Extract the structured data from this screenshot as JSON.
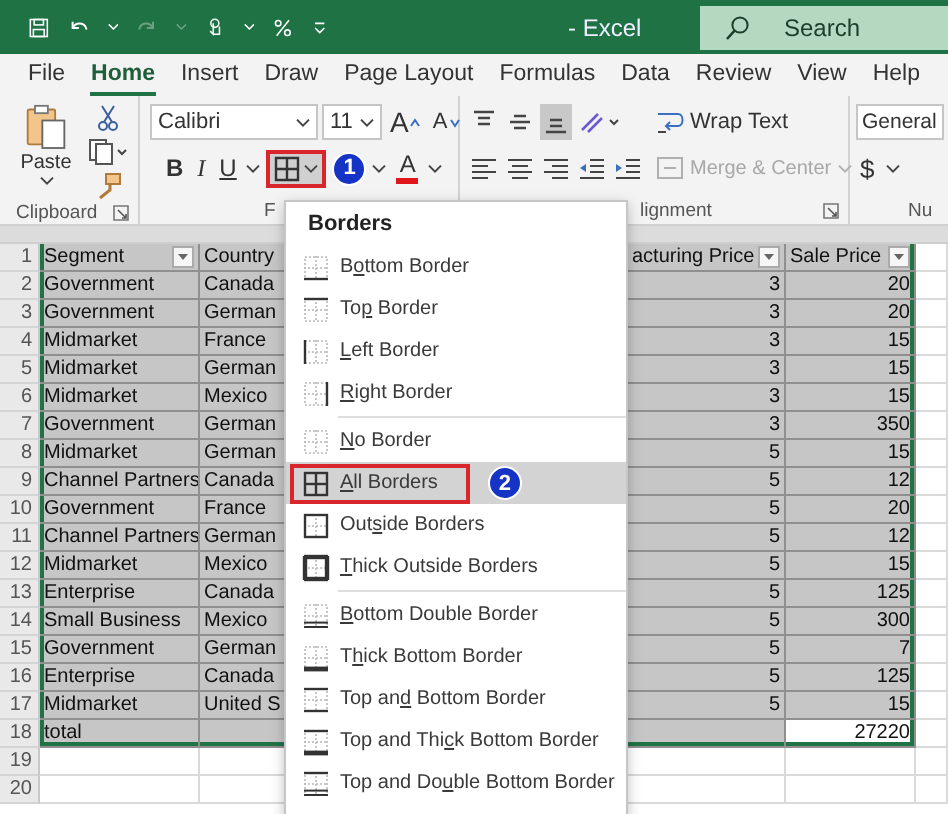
{
  "title_bar": {
    "title": "- Excel",
    "search": {
      "placeholder": "Search"
    }
  },
  "ribbon": {
    "tabs": [
      {
        "label": "File",
        "selected": false
      },
      {
        "label": "Home",
        "selected": true
      },
      {
        "label": "Insert",
        "selected": false
      },
      {
        "label": "Draw",
        "selected": false
      },
      {
        "label": "Page Layout",
        "selected": false
      },
      {
        "label": "Formulas",
        "selected": false
      },
      {
        "label": "Data",
        "selected": false
      },
      {
        "label": "Review",
        "selected": false
      },
      {
        "label": "View",
        "selected": false
      },
      {
        "label": "Help",
        "selected": false
      }
    ],
    "clipboard": {
      "paste": "Paste",
      "group": "Clipboard"
    },
    "font": {
      "name": "Calibri",
      "size": "11",
      "grow": "A",
      "shrink": "A",
      "bold": "B",
      "italic": "I",
      "underline": "U",
      "font_color": "A",
      "borders_callout": "1",
      "group": "F"
    },
    "alignment": {
      "vertical": [
        {
          "kind": "top",
          "selected": false
        },
        {
          "kind": "middle",
          "selected": false
        },
        {
          "kind": "bottom",
          "selected": true
        }
      ],
      "wrap_text": "Wrap Text",
      "merge": {
        "label": "Merge & Center",
        "disabled": true
      },
      "group": "lignment"
    },
    "number": {
      "format": "General",
      "currency": "$",
      "group": "Nu"
    }
  },
  "borders_menu": {
    "title": "Borders",
    "groups": [
      {
        "items": [
          {
            "kind": "bottom",
            "pre": "B",
            "key": "o",
            "post": "ttom Border",
            "selected": false
          },
          {
            "kind": "top",
            "pre": "To",
            "key": "p",
            "post": " Border",
            "selected": false
          },
          {
            "kind": "left",
            "key": "L",
            "post": "eft Border",
            "selected": false
          },
          {
            "kind": "right",
            "key": "R",
            "post": "ight Border",
            "selected": false
          }
        ]
      },
      {
        "items": [
          {
            "kind": "none",
            "key": "N",
            "post": "o Border",
            "selected": false
          },
          {
            "kind": "all",
            "key": "A",
            "post": "ll Borders",
            "selected": true,
            "callout": "2"
          },
          {
            "kind": "outside",
            "pre": "Out",
            "key": "s",
            "post": "ide Borders",
            "selected": false
          },
          {
            "kind": "thick_outside",
            "key": "T",
            "post": "hick Outside Borders",
            "selected": false
          }
        ]
      },
      {
        "items": [
          {
            "kind": "bottom_double",
            "key": "B",
            "post": "ottom Double Border",
            "selected": false
          },
          {
            "kind": "thick_bottom",
            "pre": "T",
            "key": "h",
            "post": "ick Bottom Border",
            "selected": false
          },
          {
            "kind": "top_bottom",
            "pre": "Top an",
            "key": "d",
            "post": " Bottom Border",
            "selected": false
          },
          {
            "kind": "top_thick_bottom",
            "pre": "Top and Thi",
            "key": "c",
            "post": "k Bottom Border",
            "selected": false
          },
          {
            "kind": "top_double_bottom",
            "pre": "Top and Do",
            "key": "u",
            "post": "ble Bottom Border",
            "selected": false
          }
        ]
      }
    ]
  },
  "sheet": {
    "columns": [
      {
        "label": "Segment",
        "kind": "text",
        "filter": true
      },
      {
        "label": "Country",
        "kind": "text",
        "filter": false
      },
      {
        "label": "acturing Price",
        "kind": "number",
        "filter": true
      },
      {
        "label": "Sale Price",
        "kind": "number",
        "filter": true
      }
    ],
    "rows": [
      {
        "number": "1",
        "kind": "header",
        "selected": true,
        "active_cell": false
      },
      {
        "number": "2",
        "kind": "data",
        "selected": true,
        "active_cell": false,
        "cells": [
          "Government",
          "Canada",
          "3",
          "20"
        ]
      },
      {
        "number": "3",
        "kind": "data",
        "selected": true,
        "active_cell": false,
        "cells": [
          "Government",
          "German",
          "3",
          "20"
        ]
      },
      {
        "number": "4",
        "kind": "data",
        "selected": true,
        "active_cell": false,
        "cells": [
          "Midmarket",
          "France",
          "3",
          "15"
        ]
      },
      {
        "number": "5",
        "kind": "data",
        "selected": true,
        "active_cell": false,
        "cells": [
          "Midmarket",
          "German",
          "3",
          "15"
        ]
      },
      {
        "number": "6",
        "kind": "data",
        "selected": true,
        "active_cell": false,
        "cells": [
          "Midmarket",
          "Mexico",
          "3",
          "15"
        ]
      },
      {
        "number": "7",
        "kind": "data",
        "selected": true,
        "active_cell": false,
        "cells": [
          "Government",
          "German",
          "3",
          "350"
        ]
      },
      {
        "number": "8",
        "kind": "data",
        "selected": true,
        "active_cell": false,
        "cells": [
          "Midmarket",
          "German",
          "5",
          "15"
        ]
      },
      {
        "number": "9",
        "kind": "data",
        "selected": true,
        "active_cell": false,
        "cells": [
          "Channel Partners",
          "Canada",
          "5",
          "12"
        ]
      },
      {
        "number": "10",
        "kind": "data",
        "selected": true,
        "active_cell": false,
        "cells": [
          "Government",
          "France",
          "5",
          "20"
        ]
      },
      {
        "number": "11",
        "kind": "data",
        "selected": true,
        "active_cell": false,
        "cells": [
          "Channel Partners",
          "German",
          "5",
          "12"
        ]
      },
      {
        "number": "12",
        "kind": "data",
        "selected": true,
        "active_cell": false,
        "cells": [
          "Midmarket",
          "Mexico",
          "5",
          "15"
        ]
      },
      {
        "number": "13",
        "kind": "data",
        "selected": true,
        "active_cell": false,
        "cells": [
          "Enterprise",
          "Canada",
          "5",
          "125"
        ]
      },
      {
        "number": "14",
        "kind": "data",
        "selected": true,
        "active_cell": false,
        "cells": [
          "Small Business",
          "Mexico",
          "5",
          "300"
        ]
      },
      {
        "number": "15",
        "kind": "data",
        "selected": true,
        "active_cell": false,
        "cells": [
          "Government",
          "German",
          "5",
          "7"
        ]
      },
      {
        "number": "16",
        "kind": "data",
        "selected": true,
        "active_cell": false,
        "cells": [
          "Enterprise",
          "Canada",
          "5",
          "125"
        ]
      },
      {
        "number": "17",
        "kind": "data",
        "selected": true,
        "active_cell": false,
        "cells": [
          "Midmarket",
          "United S",
          "5",
          "15"
        ]
      },
      {
        "number": "18",
        "kind": "data",
        "selected": true,
        "active_cell": true,
        "cells": [
          "total",
          null,
          null,
          "27220"
        ]
      },
      {
        "number": "19",
        "kind": "data",
        "selected": false,
        "active_cell": false
      },
      {
        "number": "20",
        "kind": "data",
        "selected": false,
        "active_cell": false
      }
    ]
  }
}
